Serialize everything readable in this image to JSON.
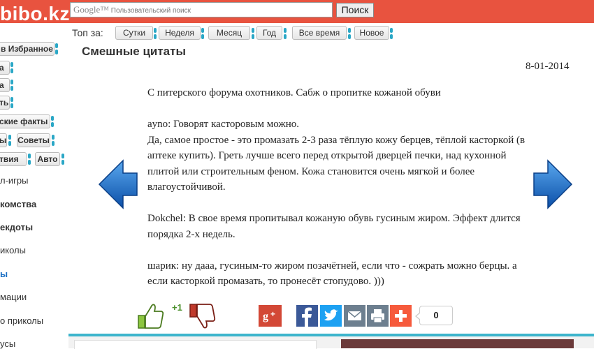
{
  "header": {
    "logo": "bibo.kz",
    "search_brand": "Google™",
    "search_placeholder": "Пользовательский поиск",
    "search_button": "Поиск"
  },
  "filters": {
    "label": "Топ за:",
    "items": [
      "Сутки",
      "Неделя",
      "Месяц",
      "Год",
      "Все время",
      "Новое"
    ]
  },
  "sidebar": {
    "buttons": [
      "в Избранное",
      "а",
      "а",
      "ть",
      "ские факты",
      "ы",
      "Советы",
      "твия",
      "Авто"
    ],
    "links": [
      "л-игры",
      "комства",
      "екдоты",
      "иколы",
      "ы",
      "мации",
      "о приколы",
      "усы"
    ]
  },
  "article": {
    "title": "Смешные цитаты",
    "date": "8-01-2014",
    "paragraphs": [
      [
        "С питерского форума охотников. Сабж о пропитке кожаной обуви"
      ],
      [
        "ayno: Говорят касторовым можно.",
        "Да, самое простое - это промазать 2-3 раза тёплую кожу берцев, тёплой касторкой (в аптеке купить). Греть лучше всего перед открытой дверцей печки, над кухонной плитой или строительным феном. Кожа становится очень мягкой и более влагоустойчивой."
      ],
      [
        "Dokchel: В свое время пропитывал кожаную обувь гусиным жиром. Эффект длится порядка 2-х недель."
      ],
      [
        "шарик: ну дааа, гусиным-то жиром позачётней, если что - сожрать можно берцы. а если касторкой промазать, то пронесёт стопудово. )))"
      ]
    ]
  },
  "rating": {
    "score": "+1"
  },
  "share": {
    "count": "0",
    "icons": [
      "google-plus-icon",
      "facebook-icon",
      "twitter-icon",
      "mail-icon",
      "print-icon",
      "more-icon"
    ]
  },
  "colors": {
    "header": "#e8533f",
    "accent": "#2aa7c6",
    "arrow": "#1a66c2"
  }
}
